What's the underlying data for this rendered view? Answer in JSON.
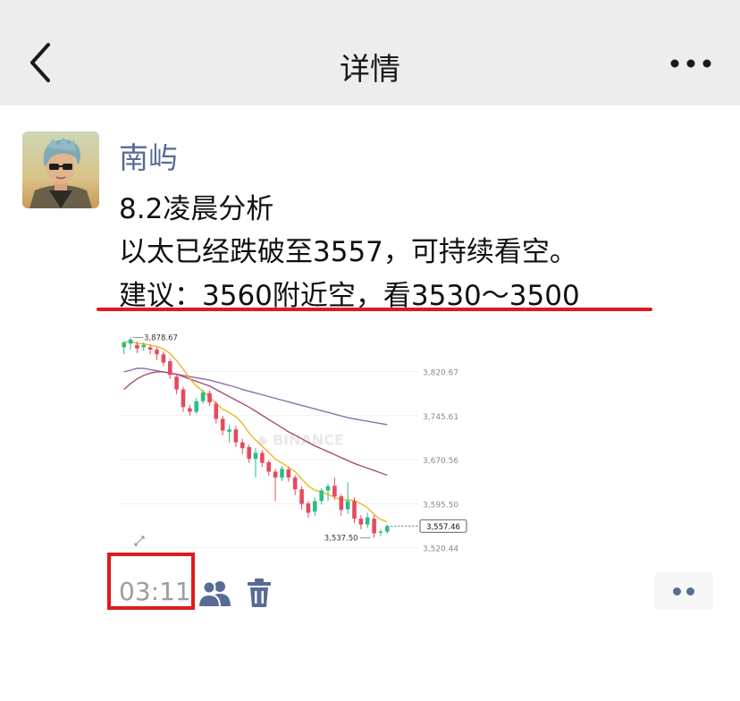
{
  "navbar": {
    "title": "详情",
    "back_icon": "chevron-left-icon",
    "more_icon": "ellipsis-icon"
  },
  "post": {
    "username": "南屿",
    "lines": [
      "8.2凌晨分析",
      "以太已经跌破至3557，可持续看空。",
      "建议：3560附近空，看3530～3500"
    ],
    "time": "03:11"
  },
  "chart_data": {
    "type": "candlestick",
    "watermark": "BINANCE",
    "y_ticks": [
      "3,820.67",
      "3,745.61",
      "3,670.56",
      "3,595.50",
      "3,520.44"
    ],
    "ylim": [
      3500,
      3890
    ],
    "high_label": "3,878.67",
    "low_label": "3,537.50",
    "last_price_label": "3,557.46",
    "colors": {
      "up": "#2ebd85",
      "down": "#e64a5f",
      "ma_fast": "#e8b923",
      "ma_mid": "#a64d79",
      "ma_slow": "#8e6fa8"
    },
    "candles": [
      [
        3862,
        3870,
        3850,
        3872
      ],
      [
        3868,
        3875,
        3858,
        3878.67
      ],
      [
        3866,
        3860,
        3852,
        3872
      ],
      [
        3862,
        3866,
        3856,
        3870
      ],
      [
        3862,
        3858,
        3850,
        3866
      ],
      [
        3858,
        3850,
        3840,
        3862
      ],
      [
        3850,
        3836,
        3830,
        3855
      ],
      [
        3838,
        3815,
        3808,
        3842
      ],
      [
        3812,
        3790,
        3782,
        3816
      ],
      [
        3790,
        3760,
        3752,
        3795
      ],
      [
        3758,
        3752,
        3745,
        3764
      ],
      [
        3752,
        3770,
        3748,
        3776
      ],
      [
        3770,
        3785,
        3766,
        3790
      ],
      [
        3784,
        3768,
        3762,
        3788
      ],
      [
        3766,
        3740,
        3732,
        3770
      ],
      [
        3740,
        3720,
        3712,
        3745
      ],
      [
        3718,
        3722,
        3700,
        3730
      ],
      [
        3722,
        3700,
        3692,
        3728
      ],
      [
        3700,
        3690,
        3680,
        3706
      ],
      [
        3692,
        3672,
        3665,
        3696
      ],
      [
        3672,
        3682,
        3640,
        3690
      ],
      [
        3682,
        3665,
        3658,
        3687
      ],
      [
        3666,
        3650,
        3643,
        3670
      ],
      [
        3650,
        3640,
        3600,
        3655
      ],
      [
        3640,
        3655,
        3634,
        3660
      ],
      [
        3654,
        3640,
        3633,
        3658
      ],
      [
        3640,
        3620,
        3610,
        3644
      ],
      [
        3620,
        3595,
        3585,
        3625
      ],
      [
        3596,
        3580,
        3572,
        3600
      ],
      [
        3582,
        3600,
        3574,
        3606
      ],
      [
        3600,
        3618,
        3594,
        3622
      ],
      [
        3618,
        3625,
        3600,
        3630
      ],
      [
        3626,
        3608,
        3602,
        3640
      ],
      [
        3608,
        3585,
        3575,
        3612
      ],
      [
        3586,
        3600,
        3578,
        3632
      ],
      [
        3600,
        3570,
        3562,
        3606
      ],
      [
        3570,
        3560,
        3552,
        3576
      ],
      [
        3560,
        3572,
        3554,
        3580
      ],
      [
        3570,
        3545,
        3537.5,
        3576
      ],
      [
        3546,
        3548,
        3540,
        3552
      ],
      [
        3548,
        3557.46,
        3544,
        3560
      ]
    ]
  }
}
